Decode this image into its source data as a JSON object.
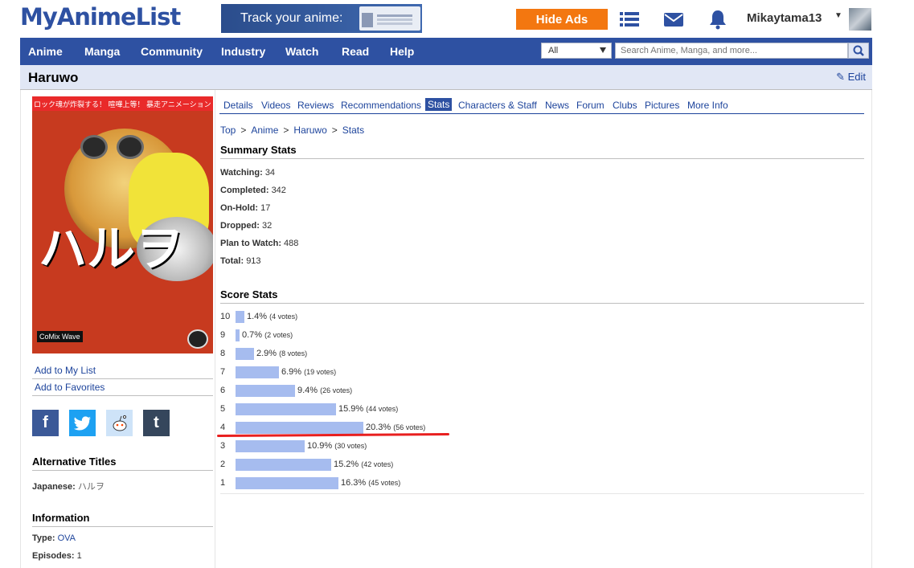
{
  "header": {
    "logo": "MyAnimeList",
    "banner_text": "Track your anime:",
    "hide_ads_label": "Hide Ads",
    "username": "Mikaytama13"
  },
  "nav": {
    "items": [
      "Anime",
      "Manga",
      "Community",
      "Industry",
      "Watch",
      "Read",
      "Help"
    ],
    "search_category": "All",
    "search_placeholder": "Search Anime, Manga, and more..."
  },
  "title": {
    "text": "Haruwo",
    "edit_label": "Edit"
  },
  "sidebar": {
    "add_to_list": "Add to My List",
    "add_to_favorites": "Add to Favorites",
    "alt_titles_heading": "Alternative Titles",
    "japanese_label": "Japanese:",
    "japanese_value": "ハルヲ",
    "information_heading": "Information",
    "type_label": "Type:",
    "type_value": "OVA",
    "episodes_label": "Episodes:",
    "episodes_value": "1"
  },
  "tabs": [
    "Details",
    "Videos",
    "Reviews",
    "Recommendations",
    "Stats",
    "Characters & Staff",
    "News",
    "Forum",
    "Clubs",
    "Pictures",
    "More Info"
  ],
  "active_tab": "Stats",
  "breadcrumb": [
    "Top",
    "Anime",
    "Haruwo",
    "Stats"
  ],
  "summary": {
    "heading": "Summary Stats",
    "rows": [
      {
        "label": "Watching:",
        "value": "34"
      },
      {
        "label": "Completed:",
        "value": "342"
      },
      {
        "label": "On-Hold:",
        "value": "17"
      },
      {
        "label": "Dropped:",
        "value": "32"
      },
      {
        "label": "Plan to Watch:",
        "value": "488"
      },
      {
        "label": "Total:",
        "value": "913"
      }
    ]
  },
  "scores": {
    "heading": "Score Stats",
    "rows": [
      {
        "score": "10",
        "percent": 1.4,
        "percent_text": "1.4%",
        "votes_text": "(4 votes)"
      },
      {
        "score": "9",
        "percent": 0.7,
        "percent_text": "0.7%",
        "votes_text": "(2 votes)"
      },
      {
        "score": "8",
        "percent": 2.9,
        "percent_text": "2.9%",
        "votes_text": "(8 votes)"
      },
      {
        "score": "7",
        "percent": 6.9,
        "percent_text": "6.9%",
        "votes_text": "(19 votes)"
      },
      {
        "score": "6",
        "percent": 9.4,
        "percent_text": "9.4%",
        "votes_text": "(26 votes)"
      },
      {
        "score": "5",
        "percent": 15.9,
        "percent_text": "15.9%",
        "votes_text": "(44 votes)"
      },
      {
        "score": "4",
        "percent": 20.3,
        "percent_text": "20.3%",
        "votes_text": "(56 votes)"
      },
      {
        "score": "3",
        "percent": 10.9,
        "percent_text": "10.9%",
        "votes_text": "(30 votes)"
      },
      {
        "score": "2",
        "percent": 15.2,
        "percent_text": "15.2%",
        "votes_text": "(42 votes)"
      },
      {
        "score": "1",
        "percent": 16.3,
        "percent_text": "16.3%",
        "votes_text": "(45 votes)"
      }
    ]
  },
  "colors": {
    "brand": "#2e51a2",
    "hide_ads": "#f37710",
    "bar": "#a6bcef",
    "annotation": "#e81f1f"
  }
}
